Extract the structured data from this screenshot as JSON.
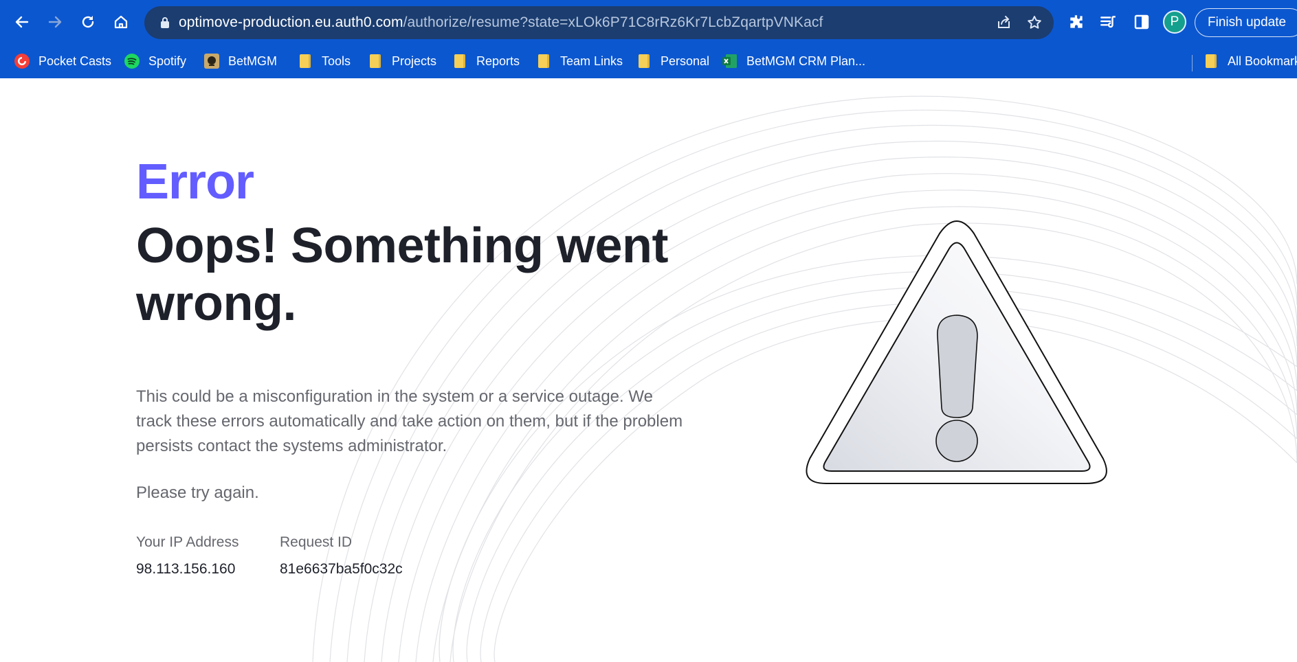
{
  "browser": {
    "url_host": "optimove-production.eu.auth0.com",
    "url_path": "/authorize/resume?state=xLOk6P71C8rRz6Kr7LcbZqartpVNKacf",
    "profile_initial": "P",
    "finish_update_label": "Finish update",
    "icons": [
      "back-arrow-icon",
      "forward-arrow-icon",
      "reload-icon",
      "home-icon",
      "lock-icon",
      "share-icon",
      "star-icon",
      "extensions-icon",
      "reading-list-icon",
      "side-panel-icon"
    ],
    "bookmarks": [
      {
        "label": "Pocket Casts",
        "icon": "pocket-casts-icon"
      },
      {
        "label": "Spotify",
        "icon": "spotify-icon"
      },
      {
        "label": "BetMGM",
        "icon": "betmgm-icon"
      },
      {
        "label": "Tools",
        "icon": "folder-icon"
      },
      {
        "label": "Projects",
        "icon": "folder-icon"
      },
      {
        "label": "Reports",
        "icon": "folder-icon"
      },
      {
        "label": "Team Links",
        "icon": "folder-icon"
      },
      {
        "label": "Personal",
        "icon": "folder-icon"
      },
      {
        "label": "BetMGM CRM Plan...",
        "icon": "excel-icon"
      },
      {
        "label": "All Bookmarks",
        "icon": "folder-icon"
      }
    ]
  },
  "page": {
    "error_label": "Error",
    "headline": "Oops! Something went wrong.",
    "description": "This could be a misconfiguration in the system or a service outage. We track these errors automatically and take action on them, but if the problem persists contact the systems administrator.",
    "retry_text": "Please try again.",
    "ip_label": "Your IP Address",
    "ip_value": "98.113.156.160",
    "request_label": "Request ID",
    "request_value": "81e6637ba5f0c32c"
  },
  "colors": {
    "chrome_bg": "#0b57d0",
    "omnibox_bg": "#1b3d70",
    "accent": "#635dff",
    "heading": "#1e212a",
    "body_text": "#65676e"
  }
}
